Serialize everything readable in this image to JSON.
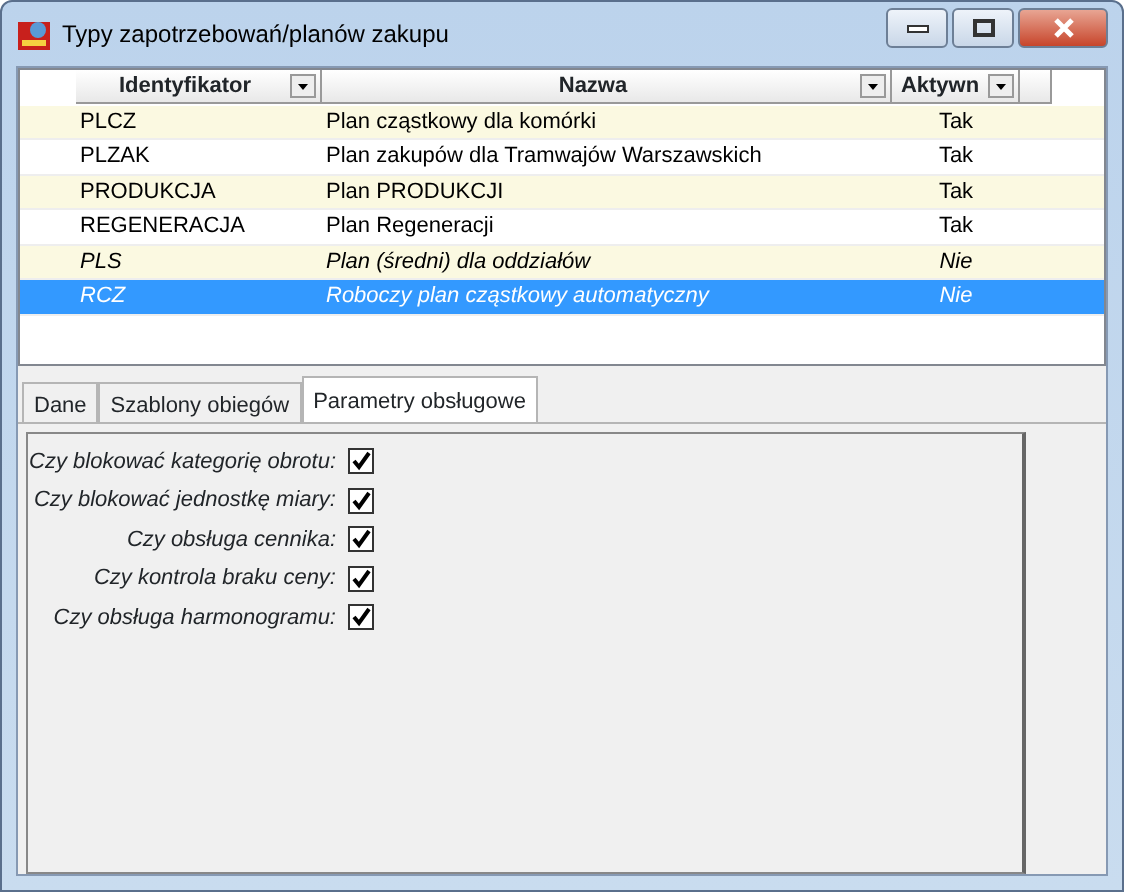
{
  "window": {
    "title": "Typy zapotrzebowań/planów zakupu"
  },
  "table": {
    "columns": [
      "Identyfikator",
      "Nazwa",
      "Aktywn"
    ],
    "rows": [
      {
        "cells": [
          "PLCZ",
          "Plan cząstkowy dla komórki",
          "Tak"
        ],
        "disabled": false,
        "selected": false
      },
      {
        "cells": [
          "PLZAK",
          "Plan zakupów dla Tramwajów Warszawskich",
          "Tak"
        ],
        "disabled": false,
        "selected": false
      },
      {
        "cells": [
          "PRODUKCJA",
          "Plan PRODUKCJI",
          "Tak"
        ],
        "disabled": false,
        "selected": false
      },
      {
        "cells": [
          "REGENERACJA",
          "Plan Regeneracji",
          "Tak"
        ],
        "disabled": false,
        "selected": false
      },
      {
        "cells": [
          "PLS",
          "Plan (średni) dla oddziałów",
          "Nie"
        ],
        "disabled": true,
        "selected": false
      },
      {
        "cells": [
          "RCZ",
          "Roboczy plan cząstkowy automatyczny",
          "Nie"
        ],
        "disabled": true,
        "selected": true
      }
    ]
  },
  "tabs": [
    {
      "label": "Dane",
      "selected": false
    },
    {
      "label": "Szablony obiegów",
      "selected": false
    },
    {
      "label": "Parametry obsługowe",
      "selected": true
    }
  ],
  "params": [
    {
      "label": "Czy blokować kategorię obrotu:",
      "checked": true
    },
    {
      "label": "Czy blokować jednostkę miary:",
      "checked": true
    },
    {
      "label": "Czy obsługa cennika:",
      "checked": true
    },
    {
      "label": "Czy kontrola braku ceny:",
      "checked": true
    },
    {
      "label": "Czy obsługa harmonogramu:",
      "checked": true
    }
  ]
}
